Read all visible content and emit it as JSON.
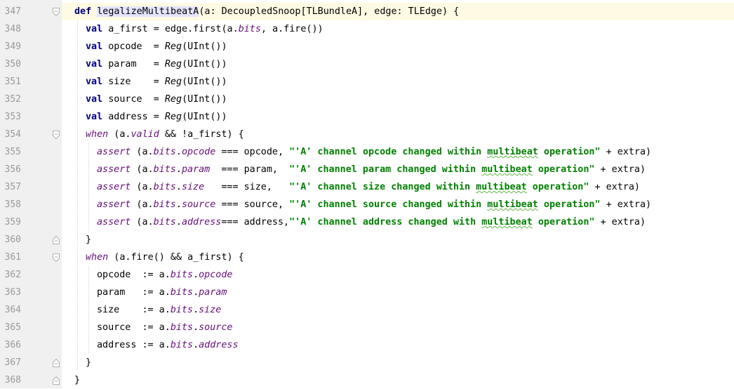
{
  "editor": {
    "lines": [
      {
        "n": "347",
        "fold": "open",
        "indent": 0,
        "tokens": [
          {
            "t": "def ",
            "c": "kw"
          },
          {
            "t": "legalizeMultibeatA",
            "c": "fn"
          },
          {
            "t": "(a: DecoupledSnoop[TLBundleA], edge: TLEdge) {",
            "c": "plain"
          }
        ]
      },
      {
        "n": "348",
        "fold": "",
        "indent": 1,
        "tokens": [
          {
            "t": "val ",
            "c": "kw"
          },
          {
            "t": "a_first = edge.first(a.",
            "c": "plain"
          },
          {
            "t": "bits",
            "c": "field"
          },
          {
            "t": ", a.fire())",
            "c": "plain"
          }
        ]
      },
      {
        "n": "349",
        "fold": "",
        "indent": 1,
        "tokens": [
          {
            "t": "val ",
            "c": "kw"
          },
          {
            "t": "opcode  = ",
            "c": "plain"
          },
          {
            "t": "Reg",
            "c": "call"
          },
          {
            "t": "(UInt())",
            "c": "plain"
          }
        ]
      },
      {
        "n": "350",
        "fold": "",
        "indent": 1,
        "tokens": [
          {
            "t": "val ",
            "c": "kw"
          },
          {
            "t": "param   = ",
            "c": "plain"
          },
          {
            "t": "Reg",
            "c": "call"
          },
          {
            "t": "(UInt())",
            "c": "plain"
          }
        ]
      },
      {
        "n": "351",
        "fold": "",
        "indent": 1,
        "tokens": [
          {
            "t": "val ",
            "c": "kw"
          },
          {
            "t": "size    = ",
            "c": "plain"
          },
          {
            "t": "Reg",
            "c": "call"
          },
          {
            "t": "(UInt())",
            "c": "plain"
          }
        ]
      },
      {
        "n": "352",
        "fold": "",
        "indent": 1,
        "tokens": [
          {
            "t": "val ",
            "c": "kw"
          },
          {
            "t": "source  = ",
            "c": "plain"
          },
          {
            "t": "Reg",
            "c": "call"
          },
          {
            "t": "(UInt())",
            "c": "plain"
          }
        ]
      },
      {
        "n": "353",
        "fold": "",
        "indent": 1,
        "tokens": [
          {
            "t": "val ",
            "c": "kw"
          },
          {
            "t": "address = ",
            "c": "plain"
          },
          {
            "t": "Reg",
            "c": "call"
          },
          {
            "t": "(UInt())",
            "c": "plain"
          }
        ]
      },
      {
        "n": "354",
        "fold": "open",
        "indent": 1,
        "tokens": [
          {
            "t": "when",
            "c": "macro"
          },
          {
            "t": " (a.",
            "c": "plain"
          },
          {
            "t": "valid",
            "c": "field"
          },
          {
            "t": " && !a_first) {",
            "c": "plain"
          }
        ]
      },
      {
        "n": "355",
        "fold": "",
        "indent": 2,
        "tokens": [
          {
            "t": "assert",
            "c": "macro"
          },
          {
            "t": " (a.",
            "c": "plain"
          },
          {
            "t": "bits",
            "c": "field"
          },
          {
            "t": ".",
            "c": "plain"
          },
          {
            "t": "opcode",
            "c": "field"
          },
          {
            "t": " === opcode, ",
            "c": "plain"
          },
          {
            "t": "\"'A' channel opcode changed within ",
            "c": "str"
          },
          {
            "t": "multibeat",
            "c": "str typo"
          },
          {
            "t": " operation\"",
            "c": "str"
          },
          {
            "t": " + extra)",
            "c": "plain"
          }
        ]
      },
      {
        "n": "356",
        "fold": "",
        "indent": 2,
        "tokens": [
          {
            "t": "assert",
            "c": "macro"
          },
          {
            "t": " (a.",
            "c": "plain"
          },
          {
            "t": "bits",
            "c": "field"
          },
          {
            "t": ".",
            "c": "plain"
          },
          {
            "t": "param",
            "c": "field"
          },
          {
            "t": "  === param,  ",
            "c": "plain"
          },
          {
            "t": "\"'A' channel param changed within ",
            "c": "str"
          },
          {
            "t": "multibeat",
            "c": "str typo"
          },
          {
            "t": " operation\"",
            "c": "str"
          },
          {
            "t": " + extra)",
            "c": "plain"
          }
        ]
      },
      {
        "n": "357",
        "fold": "",
        "indent": 2,
        "tokens": [
          {
            "t": "assert",
            "c": "macro"
          },
          {
            "t": " (a.",
            "c": "plain"
          },
          {
            "t": "bits",
            "c": "field"
          },
          {
            "t": ".",
            "c": "plain"
          },
          {
            "t": "size",
            "c": "field"
          },
          {
            "t": "   === size,   ",
            "c": "plain"
          },
          {
            "t": "\"'A' channel size changed within ",
            "c": "str"
          },
          {
            "t": "multibeat",
            "c": "str typo"
          },
          {
            "t": " operation\"",
            "c": "str"
          },
          {
            "t": " + extra)",
            "c": "plain"
          }
        ]
      },
      {
        "n": "358",
        "fold": "",
        "indent": 2,
        "tokens": [
          {
            "t": "assert",
            "c": "macro"
          },
          {
            "t": " (a.",
            "c": "plain"
          },
          {
            "t": "bits",
            "c": "field"
          },
          {
            "t": ".",
            "c": "plain"
          },
          {
            "t": "source",
            "c": "field"
          },
          {
            "t": " === source, ",
            "c": "plain"
          },
          {
            "t": "\"'A' channel source changed within ",
            "c": "str"
          },
          {
            "t": "multibeat",
            "c": "str typo"
          },
          {
            "t": " operation\"",
            "c": "str"
          },
          {
            "t": " + extra)",
            "c": "plain"
          }
        ]
      },
      {
        "n": "359",
        "fold": "",
        "indent": 2,
        "tokens": [
          {
            "t": "assert",
            "c": "macro"
          },
          {
            "t": " (a.",
            "c": "plain"
          },
          {
            "t": "bits",
            "c": "field"
          },
          {
            "t": ".",
            "c": "plain"
          },
          {
            "t": "address",
            "c": "field"
          },
          {
            "t": "=== address,",
            "c": "plain"
          },
          {
            "t": "\"'A' channel address changed with ",
            "c": "str"
          },
          {
            "t": "multibeat",
            "c": "str typo"
          },
          {
            "t": " operation\"",
            "c": "str"
          },
          {
            "t": " + extra)",
            "c": "plain"
          }
        ]
      },
      {
        "n": "360",
        "fold": "close",
        "indent": 1,
        "tokens": [
          {
            "t": "}",
            "c": "plain"
          }
        ]
      },
      {
        "n": "361",
        "fold": "open",
        "indent": 1,
        "tokens": [
          {
            "t": "when",
            "c": "macro"
          },
          {
            "t": " (a.fire() && a_first) {",
            "c": "plain"
          }
        ]
      },
      {
        "n": "362",
        "fold": "",
        "indent": 2,
        "tokens": [
          {
            "t": "opcode  := a.",
            "c": "plain"
          },
          {
            "t": "bits",
            "c": "field"
          },
          {
            "t": ".",
            "c": "plain"
          },
          {
            "t": "opcode",
            "c": "field"
          }
        ]
      },
      {
        "n": "363",
        "fold": "",
        "indent": 2,
        "tokens": [
          {
            "t": "param   := a.",
            "c": "plain"
          },
          {
            "t": "bits",
            "c": "field"
          },
          {
            "t": ".",
            "c": "plain"
          },
          {
            "t": "param",
            "c": "field"
          }
        ]
      },
      {
        "n": "364",
        "fold": "",
        "indent": 2,
        "tokens": [
          {
            "t": "size    := a.",
            "c": "plain"
          },
          {
            "t": "bits",
            "c": "field"
          },
          {
            "t": ".",
            "c": "plain"
          },
          {
            "t": "size",
            "c": "field"
          }
        ]
      },
      {
        "n": "365",
        "fold": "",
        "indent": 2,
        "tokens": [
          {
            "t": "source  := a.",
            "c": "plain"
          },
          {
            "t": "bits",
            "c": "field"
          },
          {
            "t": ".",
            "c": "plain"
          },
          {
            "t": "source",
            "c": "field"
          }
        ]
      },
      {
        "n": "366",
        "fold": "",
        "indent": 2,
        "tokens": [
          {
            "t": "address := a.",
            "c": "plain"
          },
          {
            "t": "bits",
            "c": "field"
          },
          {
            "t": ".",
            "c": "plain"
          },
          {
            "t": "address",
            "c": "field"
          }
        ]
      },
      {
        "n": "367",
        "fold": "close",
        "indent": 1,
        "tokens": [
          {
            "t": "}",
            "c": "plain"
          }
        ]
      },
      {
        "n": "368",
        "fold": "close",
        "indent": 0,
        "tokens": [
          {
            "t": "}",
            "c": "plain"
          }
        ]
      }
    ]
  },
  "colors": {
    "keyword": "#000080",
    "field": "#660e7a",
    "string": "#008000",
    "line_number": "#999999",
    "gutter": "#f0f0f0",
    "current_line": "#fffae3"
  }
}
